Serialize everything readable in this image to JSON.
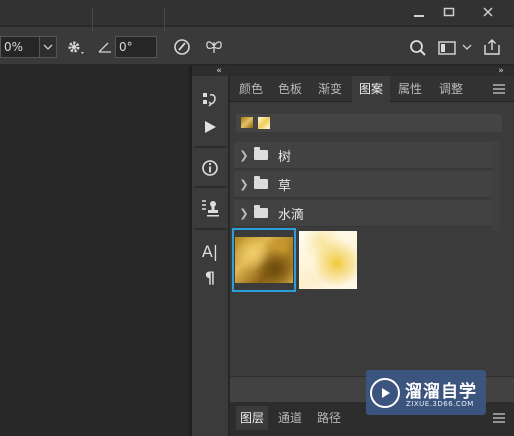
{
  "toolbar": {
    "opacity_value": "0%",
    "angle_value": "0°"
  },
  "panel": {
    "tabs": [
      {
        "label": "颜色",
        "active": false
      },
      {
        "label": "色板",
        "active": false
      },
      {
        "label": "渐变",
        "active": false
      },
      {
        "label": "图案",
        "active": true
      },
      {
        "label": "属性",
        "active": false
      },
      {
        "label": "调整",
        "active": false
      }
    ],
    "groups": [
      {
        "label": "树"
      },
      {
        "label": "草"
      },
      {
        "label": "水滴"
      }
    ]
  },
  "bottom_panel": {
    "tabs": [
      {
        "label": "图层",
        "active": true
      },
      {
        "label": "通道",
        "active": false
      },
      {
        "label": "路径",
        "active": false
      }
    ]
  },
  "strip": {
    "paragraph_glyph": "¶",
    "char_glyph": "A|"
  },
  "watermark": {
    "title": "溜溜自学",
    "url": "ZIXUE.3D66.COM"
  },
  "colors": {
    "accent": "#2d9fd8",
    "panel_bg": "#3b3b3b",
    "canvas_bg": "#282828"
  }
}
